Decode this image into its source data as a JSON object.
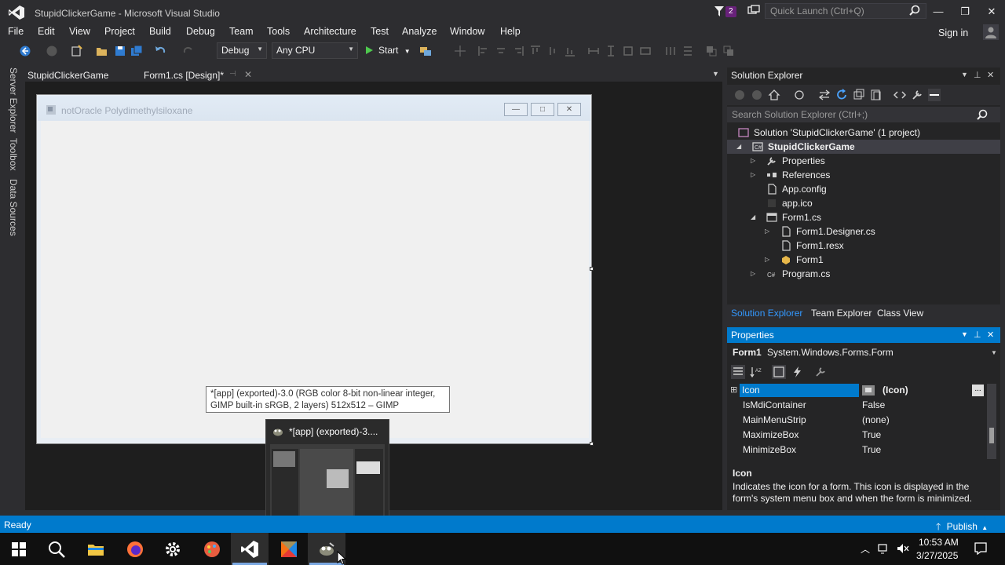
{
  "window": {
    "title": "StupidClickerGame - Microsoft Visual Studio",
    "notification_count": "2",
    "quick_launch_placeholder": "Quick Launch (Ctrl+Q)",
    "minimize": "—",
    "maximize": "❐",
    "close": "✕"
  },
  "menu": {
    "items": [
      "File",
      "Edit",
      "View",
      "Project",
      "Build",
      "Debug",
      "Team",
      "Tools",
      "Architecture",
      "Test",
      "Analyze",
      "Window",
      "Help"
    ],
    "signin": "Sign in"
  },
  "toolbar": {
    "config": "Debug",
    "platform": "Any CPU",
    "start": "Start"
  },
  "left_tabs": [
    "Server Explorer",
    "Toolbox",
    "Data Sources"
  ],
  "doc_tabs": [
    "StupidClickerGame",
    "Form1.cs [Design]*"
  ],
  "form": {
    "title": "notOracle Polydimethylsiloxane",
    "min": "—",
    "max": "□",
    "close": "✕"
  },
  "tooltip": {
    "line1": "*[app] (exported)-3.0 (RGB color 8-bit non-linear integer,",
    "line2": "GIMP built-in sRGB, 2 layers) 512x512 – GIMP"
  },
  "taskbar_preview": {
    "title": "*[app] (exported)-3...."
  },
  "solution_explorer": {
    "title": "Solution Explorer",
    "search_placeholder": "Search Solution Explorer (Ctrl+;)",
    "tree": [
      {
        "label": "Solution 'StupidClickerGame' (1 project)"
      },
      {
        "label": "StupidClickerGame"
      },
      {
        "label": "Properties"
      },
      {
        "label": "References"
      },
      {
        "label": "App.config"
      },
      {
        "label": "app.ico"
      },
      {
        "label": "Form1.cs"
      },
      {
        "label": "Form1.Designer.cs"
      },
      {
        "label": "Form1.resx"
      },
      {
        "label": "Form1"
      },
      {
        "label": "Program.cs"
      }
    ],
    "tabs": [
      "Solution Explorer",
      "Team Explorer",
      "Class View"
    ]
  },
  "properties": {
    "title": "Properties",
    "object_name": "Form1",
    "object_type": "System.Windows.Forms.Form",
    "rows": [
      {
        "name": "Icon",
        "value": "(Icon)"
      },
      {
        "name": "IsMdiContainer",
        "value": "False"
      },
      {
        "name": "MainMenuStrip",
        "value": "(none)"
      },
      {
        "name": "MaximizeBox",
        "value": "True"
      },
      {
        "name": "MinimizeBox",
        "value": "True"
      }
    ],
    "ellipsis": "...",
    "desc_title": "Icon",
    "desc_text": "Indicates the icon for a form. This icon is displayed in the form's system menu box and when the form is minimized."
  },
  "status": {
    "text": "Ready",
    "publish": "Publish"
  },
  "clock": {
    "time": "10:53 AM",
    "date": "3/27/2025"
  },
  "colors": {
    "accent": "#007acc",
    "vs_purple": "#68217a",
    "background": "#2d2d30"
  }
}
